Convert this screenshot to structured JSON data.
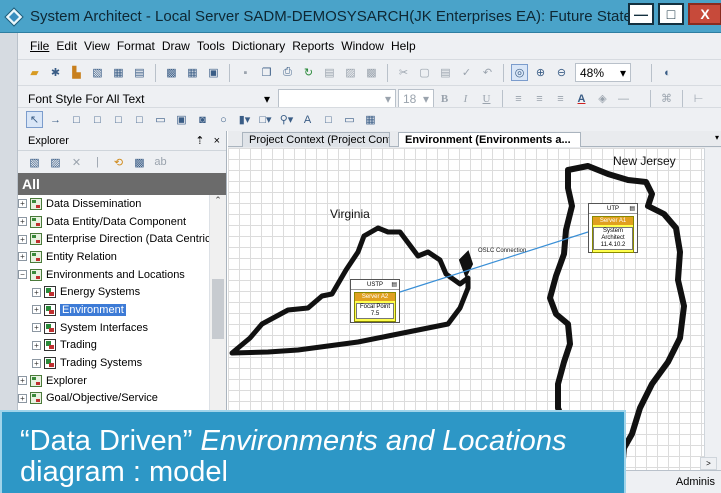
{
  "window": {
    "title": "System Architect - Local Server SADM-DEMOSYSARCH(JK Enterprises EA): Future State B",
    "minimize_glyph": "—",
    "maximize_glyph": "□",
    "close_glyph": "X"
  },
  "menu": [
    "File",
    "Edit",
    "View",
    "Format",
    "Draw",
    "Tools",
    "Dictionary",
    "Reports",
    "Window",
    "Help"
  ],
  "toolbar1": {
    "zoom_value": "48%",
    "zoom_in_icon": "⊕",
    "zoom_out_icon": "⊖"
  },
  "toolbar2": {
    "font_style": "Font Style For All Text",
    "font_size": "18",
    "bold": "B",
    "italic": "I",
    "underline": "U",
    "text_color": "A"
  },
  "explorer": {
    "title": "Explorer",
    "pin": "⇡",
    "close": "×",
    "root": "All",
    "items": [
      {
        "label": "Data Dissemination",
        "level": 0,
        "expander": "+"
      },
      {
        "label": "Data Entity/Data Component",
        "level": 0,
        "expander": "+"
      },
      {
        "label": "Enterprise Direction (Data Centric)",
        "level": 0,
        "expander": "+"
      },
      {
        "label": "Entity Relation",
        "level": 0,
        "expander": "+"
      },
      {
        "label": "Environments and Locations",
        "level": 0,
        "expander": "−"
      },
      {
        "label": "Energy Systems",
        "level": 1,
        "expander": "+"
      },
      {
        "label": "Environment",
        "level": 1,
        "expander": "+",
        "selected": true
      },
      {
        "label": "System Interfaces",
        "level": 1,
        "expander": "+"
      },
      {
        "label": "Trading",
        "level": 1,
        "expander": "+"
      },
      {
        "label": "Trading Systems",
        "level": 1,
        "expander": "+"
      },
      {
        "label": "Explorer",
        "level": 0,
        "expander": "+"
      },
      {
        "label": "Goal/Objective/Service",
        "level": 0,
        "expander": "+"
      }
    ]
  },
  "tabs": [
    {
      "label": "Project Context (Project Context)"
    },
    {
      "label": "Environment (Environments a..."
    }
  ],
  "diagram": {
    "virginia_label": "Virginia",
    "newjersey_label": "New Jersey",
    "connection_label": "OSLC Connection",
    "node_va": {
      "header": "USTP",
      "name": "Server A2",
      "system": "Focal Point",
      "version": "7.5"
    },
    "node_nj": {
      "header": "UTP",
      "name": "Server A1",
      "system": "System Architect",
      "version": "11.4.10.2"
    }
  },
  "status": {
    "user": "Adminis"
  },
  "caption": {
    "quote_part": "“Data Driven” ",
    "italic_part": "Environments and Locations",
    "rest": " diagram : model"
  },
  "colors": {
    "titlebar": "#4aa3c9",
    "caption_bg": "#2d97c6",
    "selection": "#3d7bd6",
    "node_fill": "#ffff4d"
  }
}
